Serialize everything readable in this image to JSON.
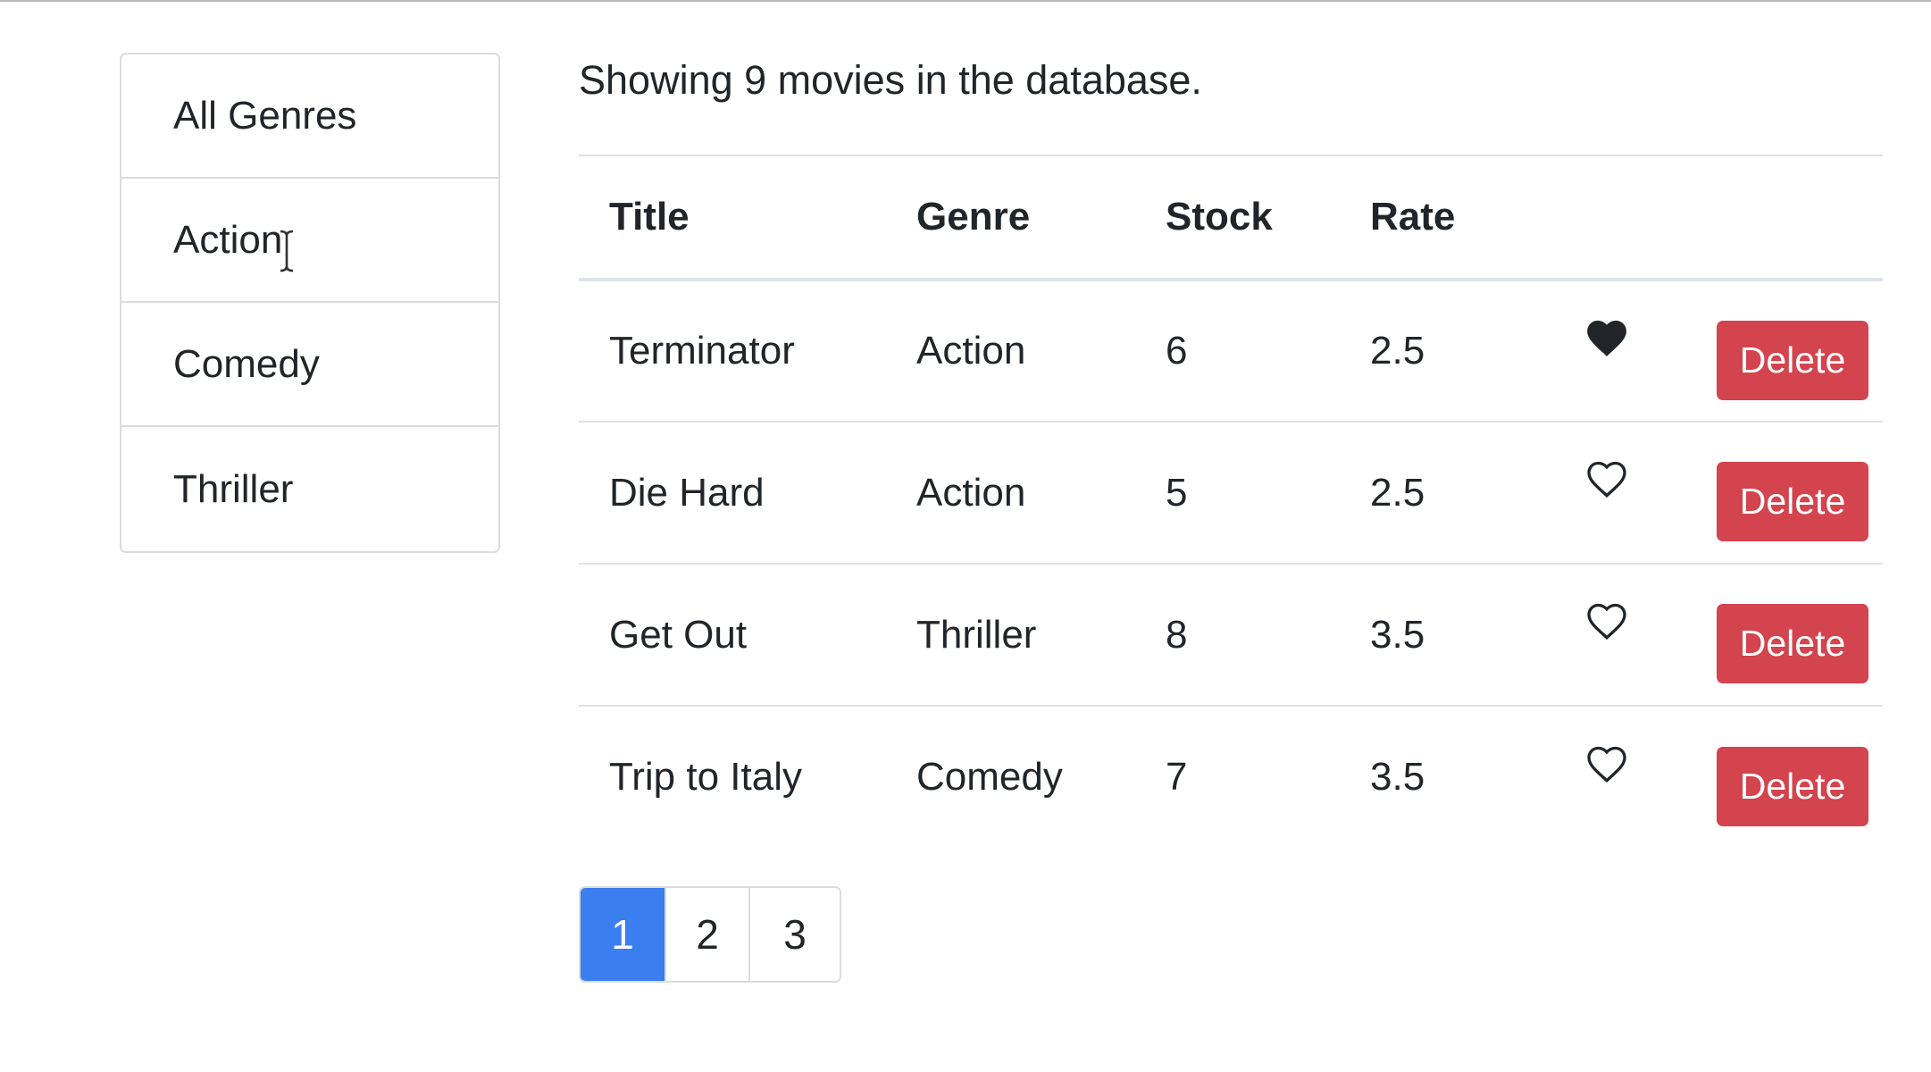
{
  "sidebar": {
    "genres": [
      {
        "label": "All Genres"
      },
      {
        "label": "Action"
      },
      {
        "label": "Comedy"
      },
      {
        "label": "Thriller"
      }
    ]
  },
  "main": {
    "summary": "Showing 9 movies in the database.",
    "table": {
      "headers": {
        "title": "Title",
        "genre": "Genre",
        "stock": "Stock",
        "rate": "Rate"
      },
      "rows": [
        {
          "title": "Terminator",
          "genre": "Action",
          "stock": "6",
          "rate": "2.5",
          "liked": true,
          "delete_label": "Delete"
        },
        {
          "title": "Die Hard",
          "genre": "Action",
          "stock": "5",
          "rate": "2.5",
          "liked": false,
          "delete_label": "Delete"
        },
        {
          "title": "Get Out",
          "genre": "Thriller",
          "stock": "8",
          "rate": "3.5",
          "liked": false,
          "delete_label": "Delete"
        },
        {
          "title": "Trip to Italy",
          "genre": "Comedy",
          "stock": "7",
          "rate": "3.5",
          "liked": false,
          "delete_label": "Delete"
        }
      ]
    },
    "pagination": {
      "pages": [
        "1",
        "2",
        "3"
      ],
      "current": "1"
    }
  },
  "colors": {
    "delete_button": "#d3444e",
    "active_page": "#3a7ef0",
    "border": "#dee2e6"
  },
  "icons": {
    "like_filled": "heart-filled-icon",
    "like_empty": "heart-outline-icon"
  }
}
